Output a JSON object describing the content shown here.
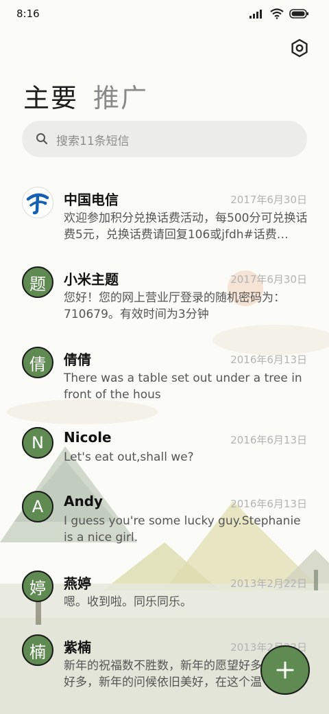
{
  "status_bar": {
    "time": "8:16"
  },
  "tabs": [
    {
      "label": "主要",
      "active": true
    },
    {
      "label": "推广",
      "active": false
    }
  ],
  "search": {
    "placeholder": "搜索11条短信"
  },
  "messages": [
    {
      "avatar": "",
      "avatar_type": "china-telecom-logo",
      "name": "中国电信",
      "date": "2017年6月30日",
      "snippet": "欢迎参加积分兑换话费活动，每500分可兑换话费5元，兑换话费请回复106或jfdh#话费…"
    },
    {
      "avatar": "题",
      "name": "小米主题",
      "date": "2017年6月30日",
      "snippet": "您好！您的网上营业厅登录的随机密码为：710679。有效时间为3分钟"
    },
    {
      "avatar": "倩",
      "name": "倩倩",
      "date": "2016年6月13日",
      "snippet": "There was a table set out under a tree in front of the hous"
    },
    {
      "avatar": "N",
      "name": "Nicole",
      "date": "2016年6月13日",
      "snippet": "Let's eat out,shall we?"
    },
    {
      "avatar": "A",
      "name": "Andy",
      "date": "2016年6月13日",
      "snippet": "I guess you're some lucky guy.Stephanie is a nice girl."
    },
    {
      "avatar": "婷",
      "name": "燕婷",
      "date": "2013年2月22日",
      "snippet": "嗯。收到啦。同乐同乐。"
    },
    {
      "avatar": "楠",
      "name": "紫楠",
      "date": "2013年2月22日",
      "snippet": "新年的祝福数不胜数，新年的愿望好多好多，新年的问候依旧美好，在这个温馨的时刻"
    }
  ],
  "colors": {
    "accent": "#5f8b52"
  }
}
